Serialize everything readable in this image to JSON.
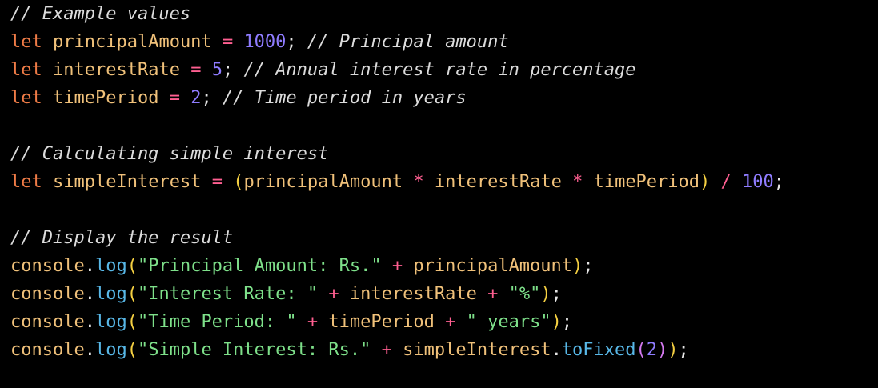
{
  "code": {
    "language": "javascript",
    "theme": {
      "background": "#000000",
      "keyword": "#f07c47",
      "identifier": "#f0c17a",
      "number": "#8f7cff",
      "comment": "#dcdcdc",
      "string": "#7ee08a",
      "operator": "#ff5f91",
      "method": "#58b8e8",
      "paren": "#f5d042",
      "paren_nested": "#d479f0",
      "punctuation": "#e6e6e6"
    },
    "lines": [
      [
        {
          "t": "comment",
          "v": "// Example values"
        }
      ],
      [
        {
          "t": "keyword",
          "v": "let"
        },
        {
          "t": "punct",
          "v": " "
        },
        {
          "t": "ident",
          "v": "principalAmount"
        },
        {
          "t": "punct",
          "v": " "
        },
        {
          "t": "operator",
          "v": "="
        },
        {
          "t": "punct",
          "v": " "
        },
        {
          "t": "number",
          "v": "1000"
        },
        {
          "t": "punct",
          "v": "; "
        },
        {
          "t": "comment",
          "v": "// Principal amount"
        }
      ],
      [
        {
          "t": "keyword",
          "v": "let"
        },
        {
          "t": "punct",
          "v": " "
        },
        {
          "t": "ident",
          "v": "interestRate"
        },
        {
          "t": "punct",
          "v": " "
        },
        {
          "t": "operator",
          "v": "="
        },
        {
          "t": "punct",
          "v": " "
        },
        {
          "t": "number",
          "v": "5"
        },
        {
          "t": "punct",
          "v": "; "
        },
        {
          "t": "comment",
          "v": "// Annual interest rate in percentage"
        }
      ],
      [
        {
          "t": "keyword",
          "v": "let"
        },
        {
          "t": "punct",
          "v": " "
        },
        {
          "t": "ident",
          "v": "timePeriod"
        },
        {
          "t": "punct",
          "v": " "
        },
        {
          "t": "operator",
          "v": "="
        },
        {
          "t": "punct",
          "v": " "
        },
        {
          "t": "number",
          "v": "2"
        },
        {
          "t": "punct",
          "v": "; "
        },
        {
          "t": "comment",
          "v": "// Time period in years"
        }
      ],
      [],
      [
        {
          "t": "comment",
          "v": "// Calculating simple interest"
        }
      ],
      [
        {
          "t": "keyword",
          "v": "let"
        },
        {
          "t": "punct",
          "v": " "
        },
        {
          "t": "ident",
          "v": "simpleInterest"
        },
        {
          "t": "punct",
          "v": " "
        },
        {
          "t": "operator",
          "v": "="
        },
        {
          "t": "punct",
          "v": " "
        },
        {
          "t": "paren",
          "v": "("
        },
        {
          "t": "ident",
          "v": "principalAmount"
        },
        {
          "t": "punct",
          "v": " "
        },
        {
          "t": "operator",
          "v": "*"
        },
        {
          "t": "punct",
          "v": " "
        },
        {
          "t": "ident",
          "v": "interestRate"
        },
        {
          "t": "punct",
          "v": " "
        },
        {
          "t": "operator",
          "v": "*"
        },
        {
          "t": "punct",
          "v": " "
        },
        {
          "t": "ident",
          "v": "timePeriod"
        },
        {
          "t": "paren",
          "v": ")"
        },
        {
          "t": "punct",
          "v": " "
        },
        {
          "t": "operator",
          "v": "/"
        },
        {
          "t": "punct",
          "v": " "
        },
        {
          "t": "number",
          "v": "100"
        },
        {
          "t": "punct",
          "v": ";"
        }
      ],
      [],
      [
        {
          "t": "comment",
          "v": "// Display the result"
        }
      ],
      [
        {
          "t": "ident",
          "v": "console"
        },
        {
          "t": "punct",
          "v": "."
        },
        {
          "t": "method",
          "v": "log"
        },
        {
          "t": "paren",
          "v": "("
        },
        {
          "t": "string",
          "v": "\"Principal Amount: Rs.\""
        },
        {
          "t": "punct",
          "v": " "
        },
        {
          "t": "operator",
          "v": "+"
        },
        {
          "t": "punct",
          "v": " "
        },
        {
          "t": "ident",
          "v": "principalAmount"
        },
        {
          "t": "paren",
          "v": ")"
        },
        {
          "t": "punct",
          "v": ";"
        }
      ],
      [
        {
          "t": "ident",
          "v": "console"
        },
        {
          "t": "punct",
          "v": "."
        },
        {
          "t": "method",
          "v": "log"
        },
        {
          "t": "paren",
          "v": "("
        },
        {
          "t": "string",
          "v": "\"Interest Rate: \""
        },
        {
          "t": "punct",
          "v": " "
        },
        {
          "t": "operator",
          "v": "+"
        },
        {
          "t": "punct",
          "v": " "
        },
        {
          "t": "ident",
          "v": "interestRate"
        },
        {
          "t": "punct",
          "v": " "
        },
        {
          "t": "operator",
          "v": "+"
        },
        {
          "t": "punct",
          "v": " "
        },
        {
          "t": "string",
          "v": "\"%\""
        },
        {
          "t": "paren",
          "v": ")"
        },
        {
          "t": "punct",
          "v": ";"
        }
      ],
      [
        {
          "t": "ident",
          "v": "console"
        },
        {
          "t": "punct",
          "v": "."
        },
        {
          "t": "method",
          "v": "log"
        },
        {
          "t": "paren",
          "v": "("
        },
        {
          "t": "string",
          "v": "\"Time Period: \""
        },
        {
          "t": "punct",
          "v": " "
        },
        {
          "t": "operator",
          "v": "+"
        },
        {
          "t": "punct",
          "v": " "
        },
        {
          "t": "ident",
          "v": "timePeriod"
        },
        {
          "t": "punct",
          "v": " "
        },
        {
          "t": "operator",
          "v": "+"
        },
        {
          "t": "punct",
          "v": " "
        },
        {
          "t": "string",
          "v": "\" years\""
        },
        {
          "t": "paren",
          "v": ")"
        },
        {
          "t": "punct",
          "v": ";"
        }
      ],
      [
        {
          "t": "ident",
          "v": "console"
        },
        {
          "t": "punct",
          "v": "."
        },
        {
          "t": "method",
          "v": "log"
        },
        {
          "t": "paren",
          "v": "("
        },
        {
          "t": "string",
          "v": "\"Simple Interest: Rs.\""
        },
        {
          "t": "punct",
          "v": " "
        },
        {
          "t": "operator",
          "v": "+"
        },
        {
          "t": "punct",
          "v": " "
        },
        {
          "t": "ident",
          "v": "simpleInterest"
        },
        {
          "t": "punct",
          "v": "."
        },
        {
          "t": "method",
          "v": "toFixed"
        },
        {
          "t": "paren2",
          "v": "("
        },
        {
          "t": "number",
          "v": "2"
        },
        {
          "t": "paren2",
          "v": ")"
        },
        {
          "t": "paren",
          "v": ")"
        },
        {
          "t": "punct",
          "v": ";"
        }
      ]
    ]
  }
}
